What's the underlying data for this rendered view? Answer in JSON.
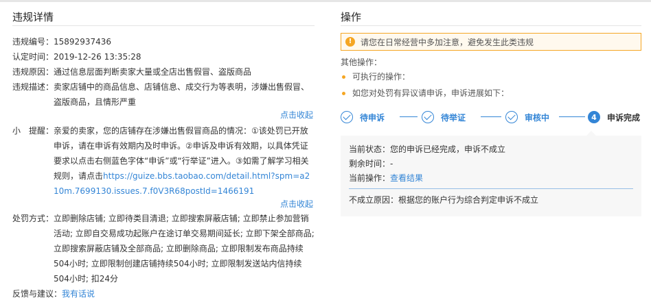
{
  "left": {
    "title": "违规详情",
    "fields": [
      {
        "k": "违规编号：",
        "v": "15892937436"
      },
      {
        "k": "认定时间：",
        "v": "2019-12-26 13:35:28"
      },
      {
        "k": "违规原因：",
        "v": "通过信息层面判断卖家大量或全店出售假冒、盗版商品"
      },
      {
        "k": "违规描述：",
        "v": "卖家店铺中的商品信息、店铺信息、成交行为等表明，涉嫌出售假冒、盗版商品，且情形严重"
      }
    ],
    "fold1": "点击收起",
    "tip_label": "小　提醒：",
    "tip_text": "亲爱的卖家，您的店铺存在涉嫌出售假冒商品的情况：①该处罚已开放申诉，请在申诉有效期内及时申诉。②申诉及申诉有效期，以具体凭证要求以点击右侧蓝色字体“申诉”或“行举证”进入。③如需了解学习相关规则，请点击",
    "tip_link": "https://guize.bbs.taobao.com/detail.html?spm=a210m.7699130.issues.7.f0V3R68postId=1466191",
    "fold2": "点击收起",
    "penalty_label": "处罚方式：",
    "penalty_text": "立即删除店铺; 立即待类目清退; 立即搜索屏蔽店铺; 立即禁止参加营销活动; 立即自交易成功起账户在途订单交易期间延长; 立即下架全部商品; 立即搜索屏蔽店铺及全部商品; 立即删除商品; 立即限制发布商品持续504小时; 立即限制创建店铺持续504小时; 立即限制发送站内信持续504小时; 扣24分",
    "feedback_label": "反馈与建议：",
    "feedback_link": "我有话说"
  },
  "right": {
    "title": "操作",
    "alert_icon": "!",
    "alert_text": "请您在日常经营中多加注意，避免发生此类违规",
    "other_title": "其他操作：",
    "bullets": [
      "可执行的操作：",
      "如您对处罚有异议请申诉，申诉进展如下："
    ],
    "steps": [
      {
        "label": "待申诉",
        "icon": "check-icon"
      },
      {
        "label": "待举证",
        "icon": "check-icon"
      },
      {
        "label": "审核中",
        "icon": "check-icon"
      },
      {
        "label": "申诉完成",
        "number": "4"
      }
    ],
    "panel": {
      "status_label": "当前状态：",
      "status_value": "您的申诉已经完成，申诉不成立",
      "remain_label": "剩余时间：",
      "remain_value": "-",
      "op_label": "当前操作：",
      "op_link": "查看结果",
      "reason_label": "不成立原因：",
      "reason_value": "根据您的账户行为综合判定申诉不成立"
    }
  },
  "colors": {
    "accent": "#3385d6",
    "warning": "#f5a623"
  }
}
